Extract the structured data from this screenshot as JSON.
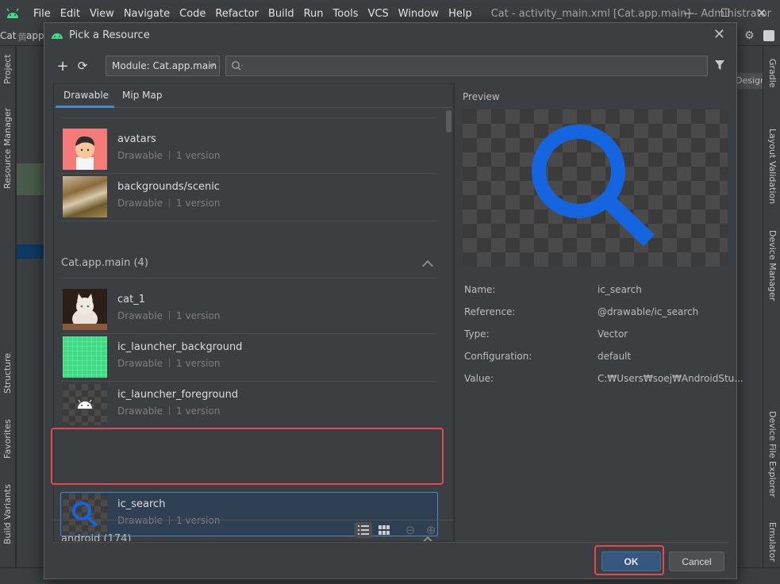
{
  "ide": {
    "menu": [
      "File",
      "Edit",
      "View",
      "Navigate",
      "Code",
      "Refactor",
      "Build",
      "Run",
      "Tools",
      "VCS",
      "Window",
      "Help"
    ],
    "window_title": "Cat - activity_main.xml [Cat.app.main] - Administrator",
    "breadcrumb": [
      "Cat",
      "app"
    ],
    "left_tabs": [
      "Project",
      "Resource Manager",
      "Structure",
      "Favorites",
      "Build Variants"
    ],
    "right_tabs": [
      "Gradle",
      "Layout Validation",
      "Device Manager",
      "Device File Explorer",
      "Emulator"
    ],
    "design_label": "Design"
  },
  "dialog": {
    "title": "Pick a Resource",
    "module_select": "Module: Cat.app.main",
    "search_placeholder": "",
    "tabs": [
      "Drawable",
      "Mip Map"
    ],
    "active_tab": "Drawable",
    "resources_top": [
      {
        "name": "avatars",
        "type": "Drawable",
        "versions": "1 version"
      },
      {
        "name": "backgrounds/scenic",
        "type": "Drawable",
        "versions": "1 version"
      }
    ],
    "section_main": "Cat.app.main (4)",
    "resources_main": [
      {
        "name": "cat_1",
        "type": "Drawable",
        "versions": "1 version"
      },
      {
        "name": "ic_launcher_background",
        "type": "Drawable",
        "versions": "1 version"
      },
      {
        "name": "ic_launcher_foreground",
        "type": "Drawable",
        "versions": "1 version"
      },
      {
        "name": "ic_search",
        "type": "Drawable",
        "versions": "1 version"
      }
    ],
    "section_android": "android (174)",
    "preview_label": "Preview",
    "properties": [
      {
        "label": "Name:",
        "value": "ic_search"
      },
      {
        "label": "Reference:",
        "value": "@drawable/ic_search"
      },
      {
        "label": "Type:",
        "value": "Vector"
      },
      {
        "label": "Configuration:",
        "value": "default"
      },
      {
        "label": "Value:",
        "value": "C:₩Users₩soej₩AndroidStu..."
      }
    ],
    "ok_label": "OK",
    "cancel_label": "Cancel"
  },
  "colors": {
    "accent": "#4a88c7",
    "highlight": "#e8474f",
    "search_icon_blue": "#1565e0"
  }
}
